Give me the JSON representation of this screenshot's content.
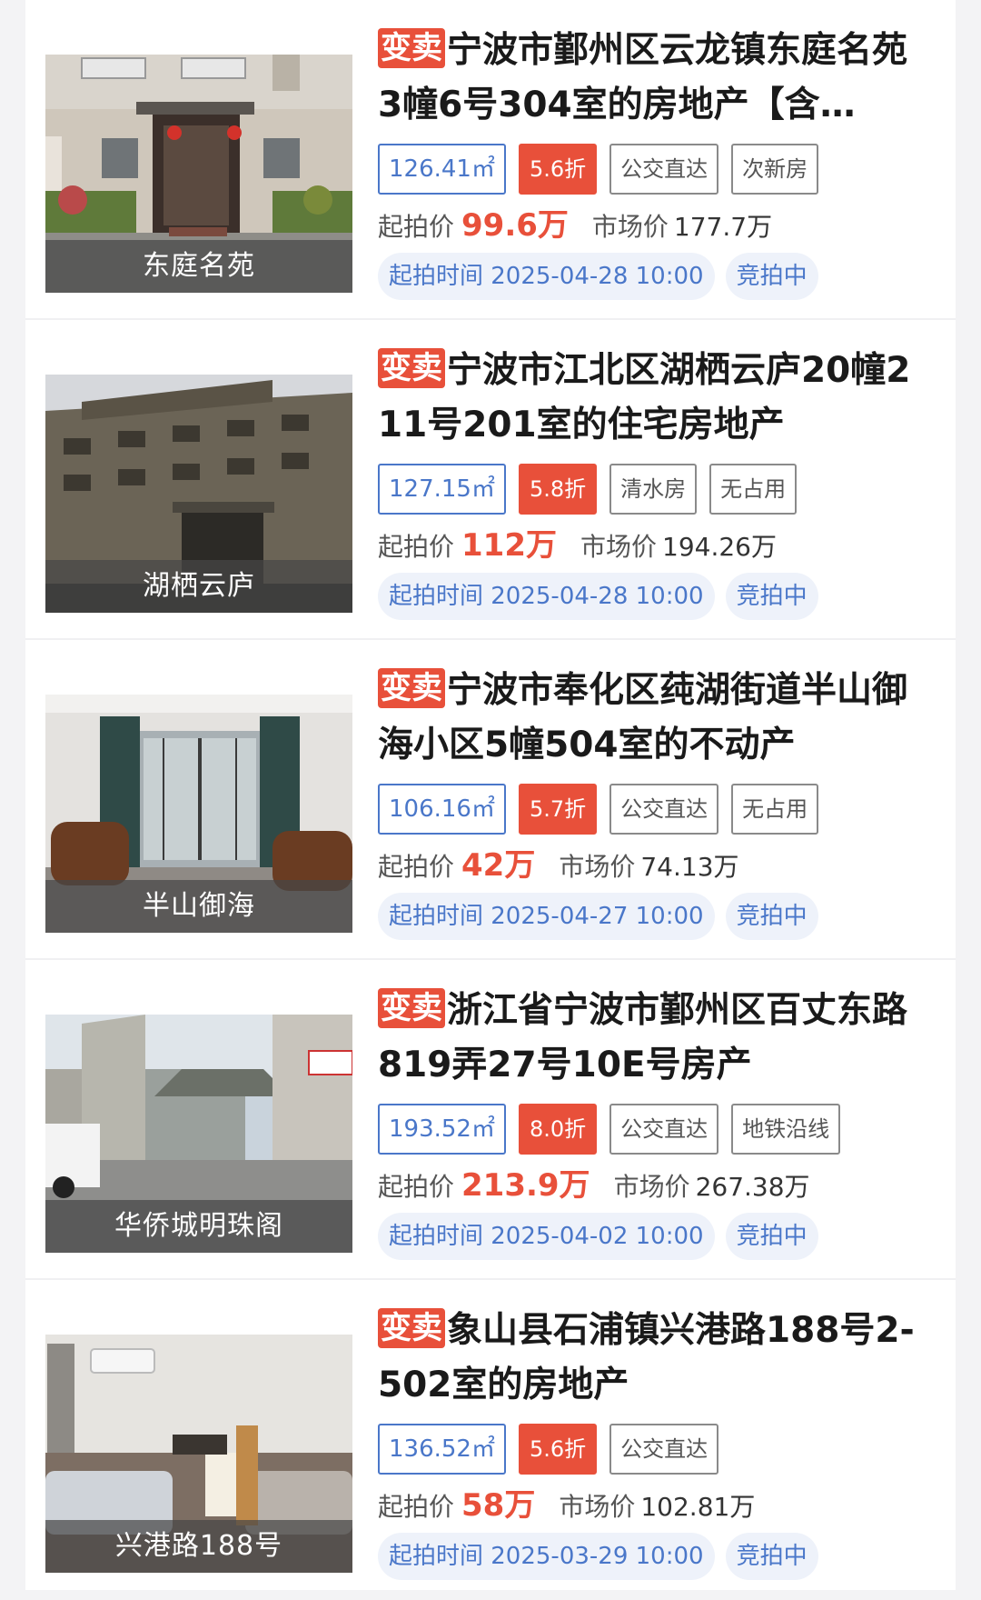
{
  "listings": [
    {
      "sale_tag": "变卖",
      "title": "宁波市鄞州区云龙镇东庭名苑3幢6号304室的房地产【含…",
      "thumb_caption": "东庭名苑",
      "area": "126.41㎡",
      "discount": "5.6折",
      "tag1": "公交直达",
      "tag2": "次新房",
      "start_price_label": "起拍价",
      "start_price": "99.6万",
      "market_price_label": "市场价",
      "market_price": "177.7万",
      "start_time": "起拍时间 2025-04-28 10:00",
      "status": "竞拍中"
    },
    {
      "sale_tag": "变卖",
      "title": "宁波市江北区湖栖云庐20幢211号201室的住宅房地产",
      "thumb_caption": "湖栖云庐",
      "area": "127.15㎡",
      "discount": "5.8折",
      "tag1": "清水房",
      "tag2": "无占用",
      "start_price_label": "起拍价",
      "start_price": "112万",
      "market_price_label": "市场价",
      "market_price": "194.26万",
      "start_time": "起拍时间 2025-04-28 10:00",
      "status": "竞拍中"
    },
    {
      "sale_tag": "变卖",
      "title": "宁波市奉化区莼湖街道半山御海小区5幢504室的不动产",
      "thumb_caption": "半山御海",
      "area": "106.16㎡",
      "discount": "5.7折",
      "tag1": "公交直达",
      "tag2": "无占用",
      "start_price_label": "起拍价",
      "start_price": "42万",
      "market_price_label": "市场价",
      "market_price": "74.13万",
      "start_time": "起拍时间 2025-04-27 10:00",
      "status": "竞拍中"
    },
    {
      "sale_tag": "变卖",
      "title": "浙江省宁波市鄞州区百丈东路819弄27号10E号房产",
      "thumb_caption": "华侨城明珠阁",
      "area": "193.52㎡",
      "discount": "8.0折",
      "tag1": "公交直达",
      "tag2": "地铁沿线",
      "start_price_label": "起拍价",
      "start_price": "213.9万",
      "market_price_label": "市场价",
      "market_price": "267.38万",
      "start_time": "起拍时间 2025-04-02 10:00",
      "status": "竞拍中"
    },
    {
      "sale_tag": "变卖",
      "title": "象山县石浦镇兴港路188号2-502室的房地产",
      "thumb_caption": "兴港路188号",
      "area": "136.52㎡",
      "discount": "5.6折",
      "tag1": "公交直达",
      "tag2": "",
      "start_price_label": "起拍价",
      "start_price": "58万",
      "market_price_label": "市场价",
      "market_price": "102.81万",
      "start_time": "起拍时间 2025-03-29 10:00",
      "status": "竞拍中"
    }
  ],
  "colors": {
    "accent_red": "#e8503a",
    "accent_blue": "#4a77c9",
    "pill_bg": "#eef2fa"
  }
}
